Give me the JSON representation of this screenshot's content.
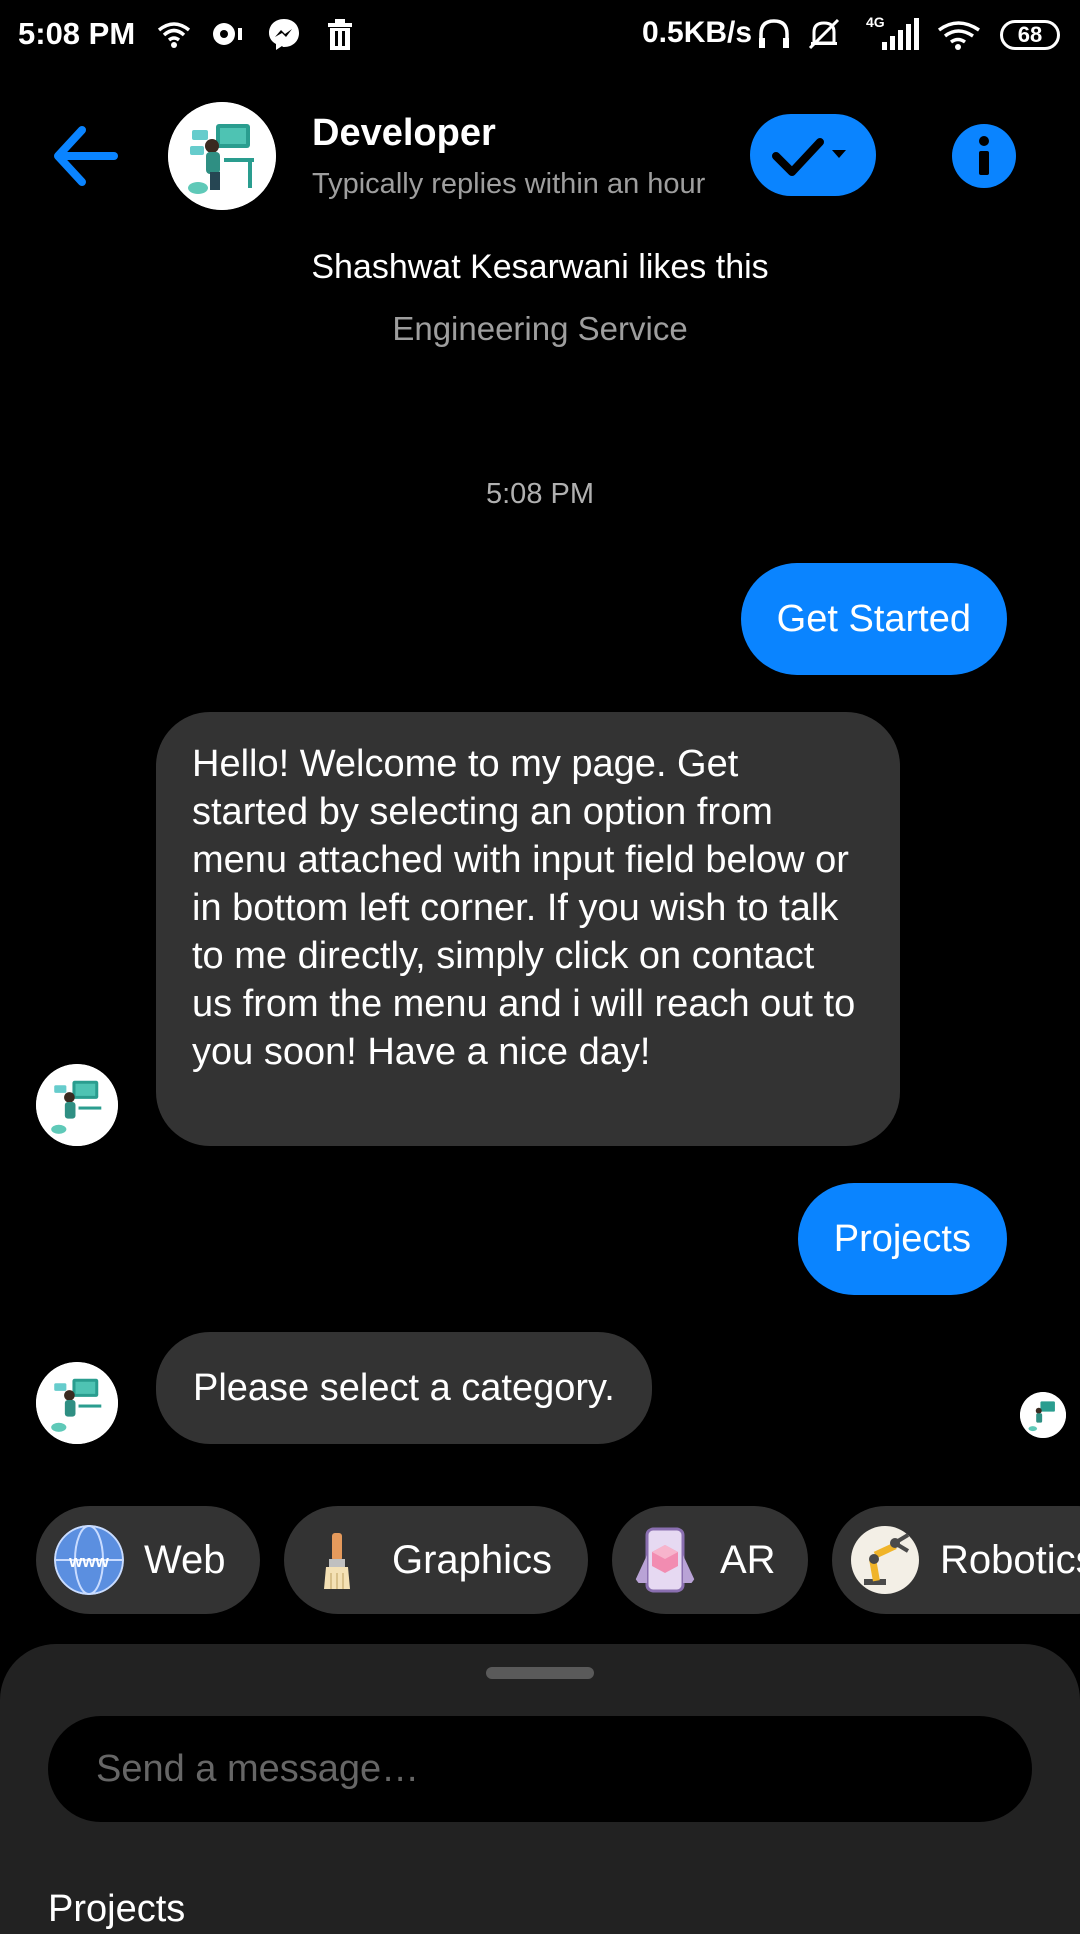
{
  "status_bar": {
    "time": "5:08 PM",
    "net_speed": "0.5KB/s",
    "network_type": "4G",
    "battery": "68",
    "icons": [
      "wifi-icon",
      "vpn-key-icon",
      "messenger-icon",
      "trash-icon",
      "headphones-icon",
      "bell-off-icon",
      "signal-icon",
      "wifi-icon",
      "battery-icon"
    ]
  },
  "header": {
    "name": "Developer",
    "subtitle": "Typically replies within an hour",
    "accent_color": "#0a84ff"
  },
  "page_info": {
    "likes": "Shashwat Kesarwani likes this",
    "category": "Engineering Service"
  },
  "conversation": {
    "timestamp": "5:08 PM",
    "messages": [
      {
        "from": "me",
        "text": "Get Started"
      },
      {
        "from": "page",
        "text": "Hello! Welcome to my page. Get started by selecting an option from menu attached with input field below or in bottom left corner. If you wish to talk to me directly, simply click on contact us from the menu and i will reach out to you soon! Have a nice day!"
      },
      {
        "from": "me",
        "text": "Projects"
      },
      {
        "from": "page",
        "text": "Please select a category."
      }
    ]
  },
  "quick_replies": [
    {
      "label": "Web",
      "icon": "globe-icon"
    },
    {
      "label": "Graphics",
      "icon": "paintbrush-icon"
    },
    {
      "label": "AR",
      "icon": "ar-headset-icon"
    },
    {
      "label": "Robotics",
      "icon": "robot-arm-icon"
    }
  ],
  "composer": {
    "placeholder": "Send a message…",
    "menu_item": "Projects"
  }
}
